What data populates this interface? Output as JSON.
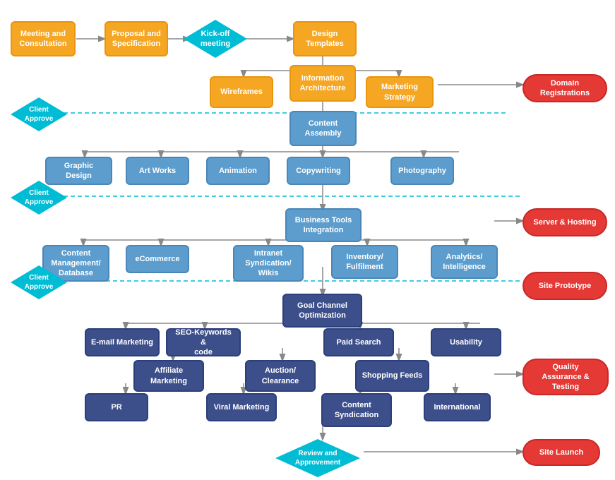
{
  "nodes": {
    "meeting": {
      "label": "Meeting and\nConsultation"
    },
    "proposal": {
      "label": "Proposal and\nSpecification"
    },
    "kickoff": {
      "label": "Kick-off\nmeeting"
    },
    "design_templates": {
      "label": "Design\nTemplates"
    },
    "wireframes": {
      "label": "Wireframes"
    },
    "info_arch": {
      "label": "Information\nArchitecture"
    },
    "marketing_strategy": {
      "label": "Marketing\nStrategy"
    },
    "domain_reg": {
      "label": "Domain\nRegistrations"
    },
    "client_approve1": {
      "label": "Client\nApprove"
    },
    "content_assembly": {
      "label": "Content\nAssembly"
    },
    "graphic_design": {
      "label": "Graphic Design"
    },
    "art_works": {
      "label": "Art Works"
    },
    "animation": {
      "label": "Animation"
    },
    "copywriting": {
      "label": "Copywriting"
    },
    "photography": {
      "label": "Photography"
    },
    "client_approve2": {
      "label": "Client\nApprove"
    },
    "server_hosting": {
      "label": "Server & Hosting"
    },
    "biz_tools": {
      "label": "Business Tools\nIntegration"
    },
    "content_mgmt": {
      "label": "Content\nManagement/\nDatabase"
    },
    "ecommerce": {
      "label": "eCommerce"
    },
    "intranet": {
      "label": "Intranet\nSyndication/\nWikis"
    },
    "inventory": {
      "label": "Inventory/\nFulfilment"
    },
    "analytics": {
      "label": "Analytics/\nIntelligence"
    },
    "client_approve3": {
      "label": "Client\nApprove"
    },
    "site_prototype": {
      "label": "Site Prototype"
    },
    "goal_channel": {
      "label": "Goal Channel\nOptimization"
    },
    "email_marketing": {
      "label": "E-mail Marketing"
    },
    "seo_keywords": {
      "label": "SEO-Keywords &\ncode"
    },
    "paid_search": {
      "label": "Paid Search"
    },
    "usability": {
      "label": "Usability"
    },
    "affiliate": {
      "label": "Affiliate\nMarketing"
    },
    "auction": {
      "label": "Auction/\nClearance"
    },
    "shopping_feeds": {
      "label": "Shopping Feeds"
    },
    "pr": {
      "label": "PR"
    },
    "viral_marketing": {
      "label": "Viral Marketing"
    },
    "content_syndication": {
      "label": "Content\nSyndication"
    },
    "international": {
      "label": "International"
    },
    "qa_testing": {
      "label": "Quality\nAssurance &\nTesting"
    },
    "review": {
      "label": "Review and\nApprovement"
    },
    "site_launch": {
      "label": "Site Launch"
    }
  }
}
